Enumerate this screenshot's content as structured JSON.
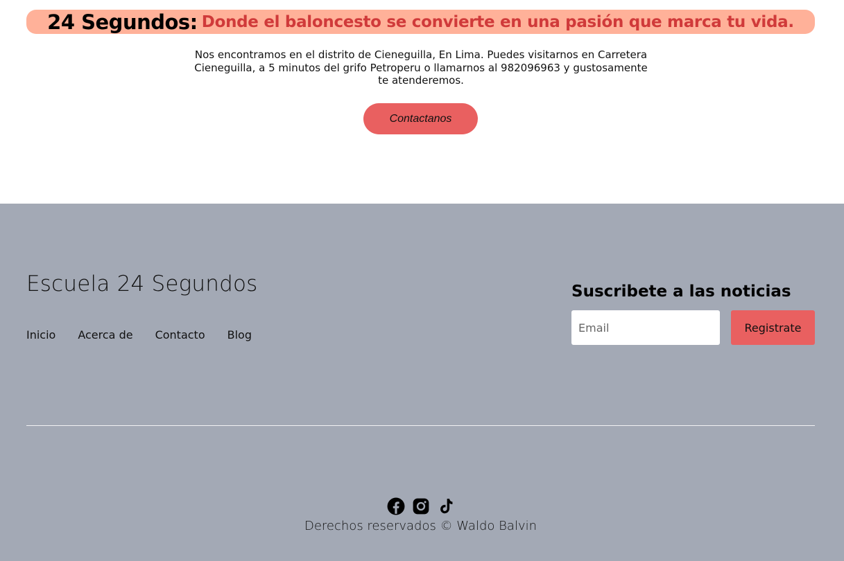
{
  "hero": {
    "title": "24 Segundos:",
    "tagline": "Donde el baloncesto se convierte en una pasión que marca tu vida.",
    "description": "Nos encontramos en el distrito de Cieneguilla, En Lima. Puedes visitarnos en Carretera Cieneguilla, a 5 minutos del grifo Petroperu o llamarnos al 982096963 y gustosamente te atenderemos.",
    "cta_label": "Contactanos"
  },
  "footer": {
    "brand": "Escuela 24 Segundos",
    "nav": [
      "Inicio",
      "Acerca de",
      "Contacto",
      "Blog"
    ],
    "subscribe": {
      "title": "Suscribete a las noticias",
      "email_placeholder": "Email",
      "email_value": "",
      "button_label": "Registrate"
    },
    "socials": [
      "facebook-icon",
      "instagram-icon",
      "tiktok-icon"
    ],
    "copyright": "Derechos reservados © Waldo Balvin"
  },
  "colors": {
    "banner_bg": "#ffb199",
    "accent_red": "#d03a3a",
    "button_red": "#e96060",
    "footer_bg": "#a3a9b5"
  }
}
